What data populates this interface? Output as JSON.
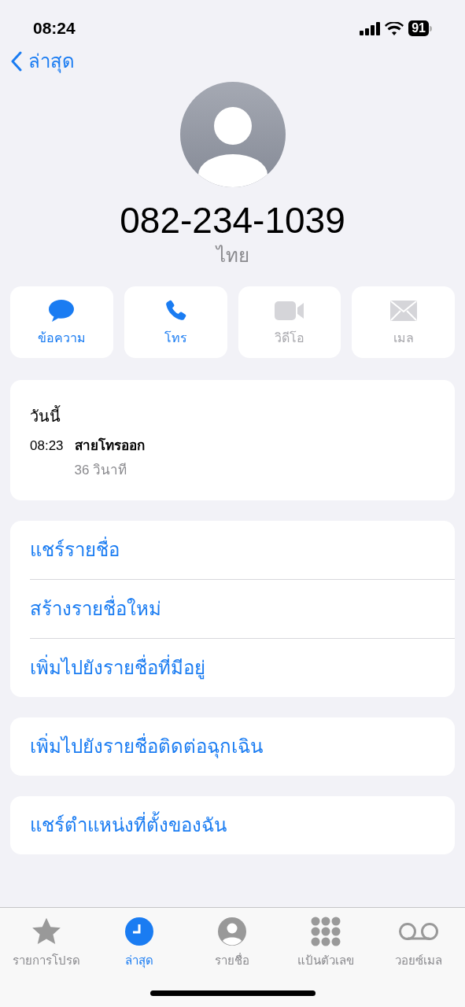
{
  "status_bar": {
    "time": "08:24",
    "battery": "91"
  },
  "nav": {
    "back_label": "ล่าสุด"
  },
  "contact": {
    "number": "082-234-1039",
    "country": "ไทย"
  },
  "actions": [
    {
      "kind": "message",
      "label": "ข้อความ",
      "disabled": false
    },
    {
      "kind": "call",
      "label": "โทร",
      "disabled": false
    },
    {
      "kind": "video",
      "label": "วิดีโอ",
      "disabled": true
    },
    {
      "kind": "mail",
      "label": "เมล",
      "disabled": true
    }
  ],
  "recent": {
    "heading": "วันนี้",
    "time": "08:23",
    "type": "สายโทรออก",
    "duration": "36 วินาที"
  },
  "option_groups": [
    [
      "แชร์รายชื่อ",
      "สร้างรายชื่อใหม่",
      "เพิ่มไปยังรายชื่อที่มีอยู่"
    ],
    [
      "เพิ่มไปยังรายชื่อติดต่อฉุกเฉิน"
    ],
    [
      "แชร์ตำแหน่งที่ตั้งของฉัน"
    ]
  ],
  "tabs": [
    {
      "kind": "favorites",
      "label": "รายการโปรด",
      "selected": false
    },
    {
      "kind": "recents",
      "label": "ล่าสุด",
      "selected": true
    },
    {
      "kind": "contacts",
      "label": "รายชื่อ",
      "selected": false
    },
    {
      "kind": "keypad",
      "label": "แป้นตัวเลข",
      "selected": false
    },
    {
      "kind": "voicemail",
      "label": "วอยซ์เมล",
      "selected": false
    }
  ]
}
